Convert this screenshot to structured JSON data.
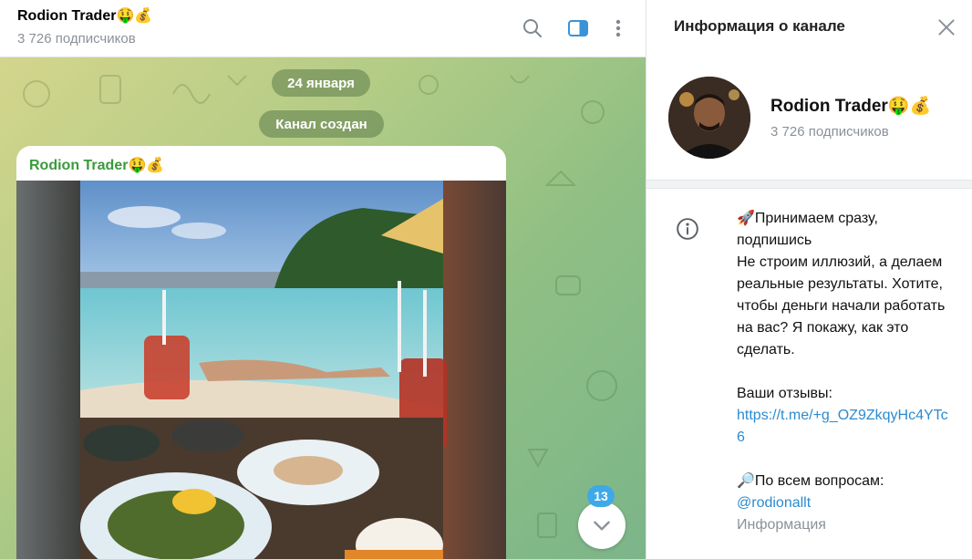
{
  "chat": {
    "title": "Rodion Trader🤑💰",
    "subscribers": "3 726 подписчиков",
    "date_pill": "24 января",
    "service_pill": "Канал создан",
    "message": {
      "author": "Rodion Trader🤑💰"
    },
    "unread_count": "13",
    "icons": {
      "search": "search-icon",
      "sidebar": "sidebar-toggle-icon",
      "menu": "more-vertical-icon",
      "scroll": "chevron-down-icon"
    }
  },
  "panel": {
    "title": "Информация о канале",
    "channel_name": "Rodion Trader🤑💰",
    "subscribers": "3 726 подписчиков",
    "description": {
      "line1": "🚀Принимаем сразу, подпишись",
      "line2": "Не строим иллюзий, а делаем реальные результаты. Хотите, чтобы деньги начали работать на вас? Я покажу, как это сделать.",
      "reviews_label": "Ваши отзывы:",
      "reviews_link": "https://t.me/+g_OZ9ZkqyHc4YTc6",
      "questions_label": "🔎По всем вопросам:",
      "questions_link": "@rodionallt",
      "caption": "Информация"
    }
  },
  "colors": {
    "accent": "#3fa9e8",
    "author": "#3a9a3c",
    "link": "#2b8bd0",
    "muted": "#8b9198"
  }
}
